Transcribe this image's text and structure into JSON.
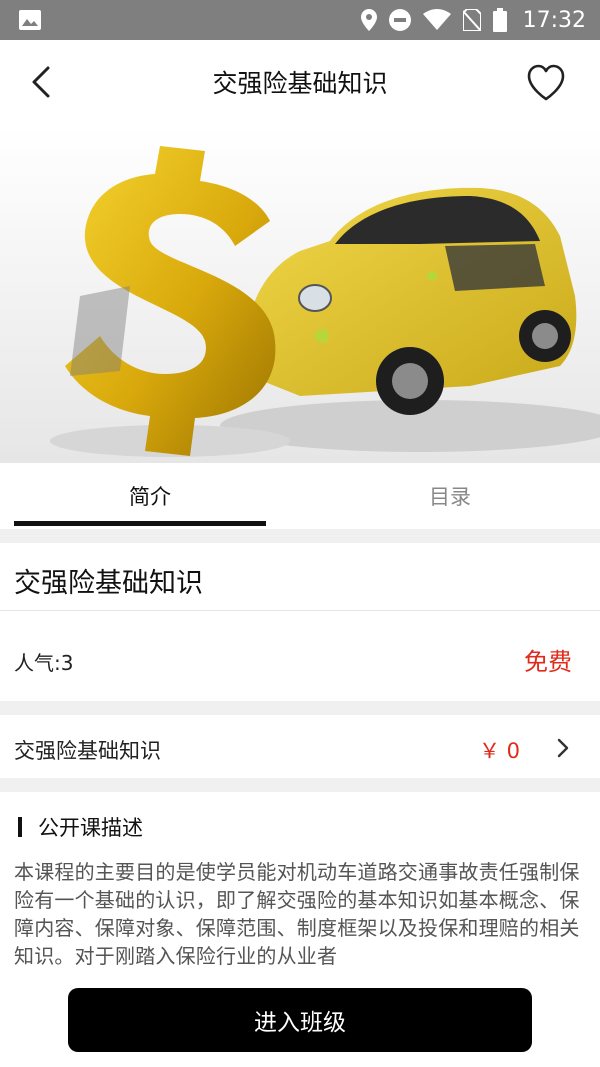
{
  "status_bar": {
    "time": "17:32"
  },
  "header": {
    "title": "交强险基础知识"
  },
  "tabs": [
    {
      "label": "简介",
      "active": true
    },
    {
      "label": "目录",
      "active": false
    }
  ],
  "course": {
    "title": "交强险基础知识",
    "popularity": "人气:3",
    "price": "免费"
  },
  "lesson": {
    "name": "交强险基础知识",
    "price": "￥ 0"
  },
  "description": {
    "heading": "公开课描述",
    "text": "本课程的主要目的是使学员能对机动车道路交通事故责任强制保险有一个基础的认识，即了解交强险的基本知识如基本概念、保障内容、保障对象、保障范围、制度框架以及投保和理赔的相关知识。对于刚踏入保险行业的从业者"
  },
  "footer": {
    "enter_label": "进入班级"
  },
  "colors": {
    "accent_red": "#e02b1c",
    "button_bg": "#000000"
  },
  "icons": {
    "status_left": "image-icon",
    "status_right": [
      "location-icon",
      "do-not-disturb-icon",
      "wifi-icon",
      "no-sim-icon",
      "battery-icon"
    ],
    "nav": [
      "back-arrow-icon",
      "heart-icon"
    ],
    "banner": "gold-dollar-crashed-car-image"
  }
}
